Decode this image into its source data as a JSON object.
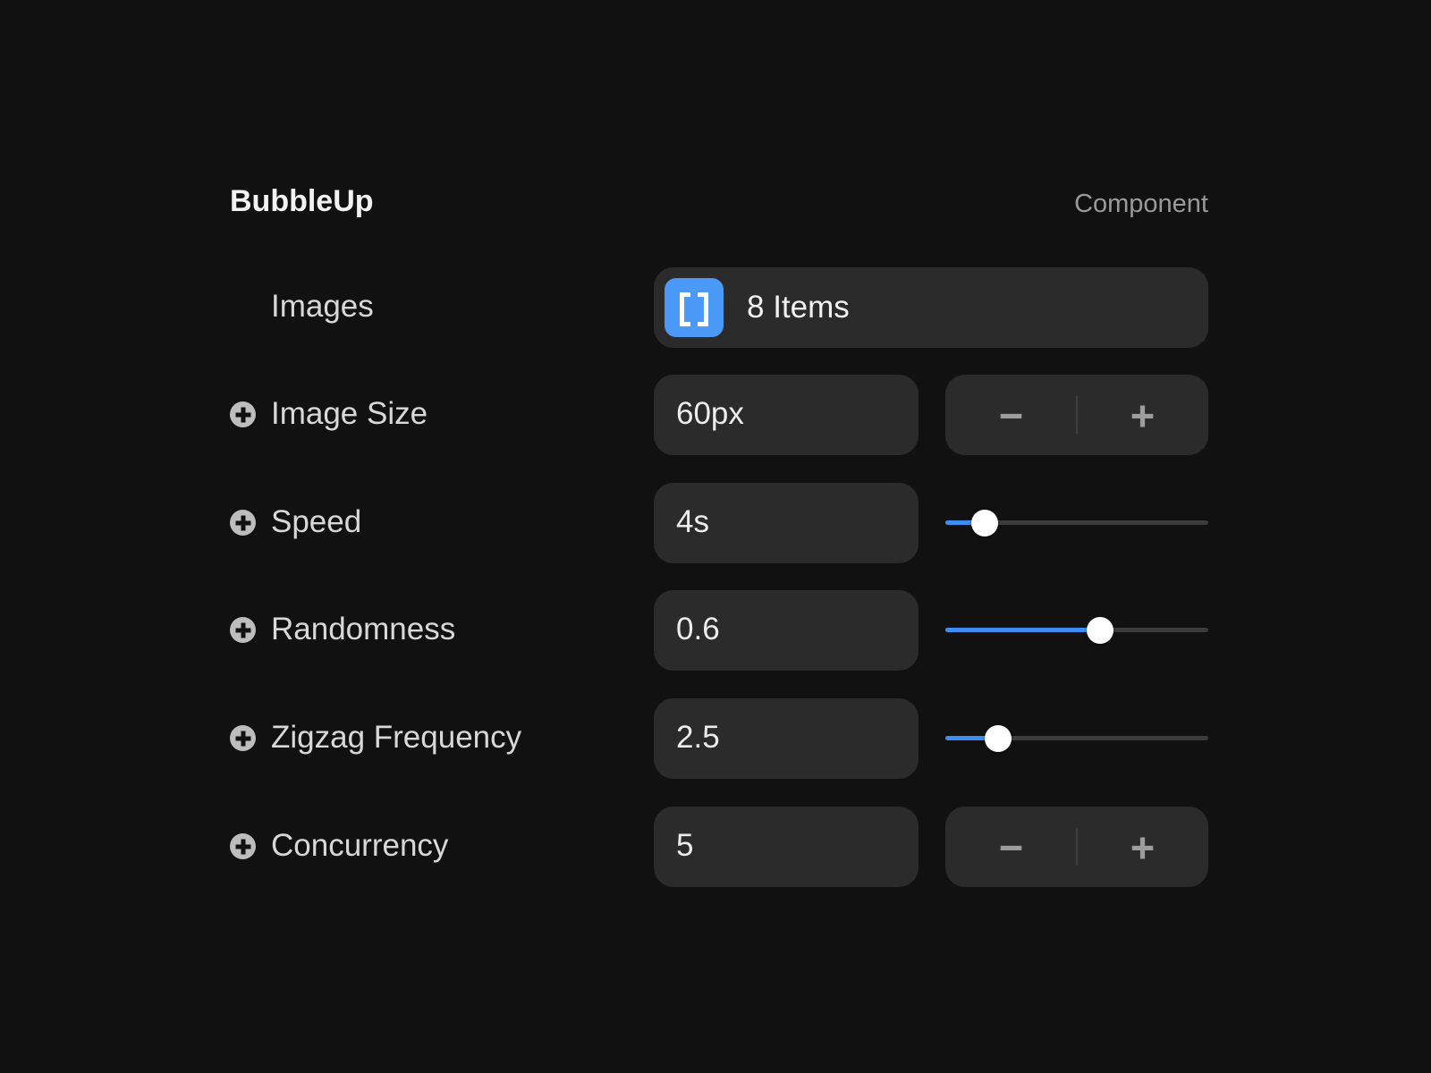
{
  "panel": {
    "title": "BubbleUp",
    "type_label": "Component"
  },
  "images": {
    "label": "Images",
    "summary": "8 Items",
    "icon": "array-brackets-icon",
    "icon_color": "#4b9af7"
  },
  "image_size": {
    "label": "Image Size",
    "value": "60px",
    "minus_label": "−",
    "plus_label": "+"
  },
  "speed": {
    "label": "Speed",
    "value": "4s",
    "slider_fraction": 0.15
  },
  "randomness": {
    "label": "Randomness",
    "value": "0.6",
    "slider_fraction": 0.59
  },
  "zigzag_frequency": {
    "label": "Zigzag Frequency",
    "value": "2.5",
    "slider_fraction": 0.2
  },
  "concurrency": {
    "label": "Concurrency",
    "value": "5",
    "minus_label": "−",
    "plus_label": "+"
  },
  "colors": {
    "background": "#111111",
    "field": "#2b2b2b",
    "accent": "#3d8ef4"
  }
}
